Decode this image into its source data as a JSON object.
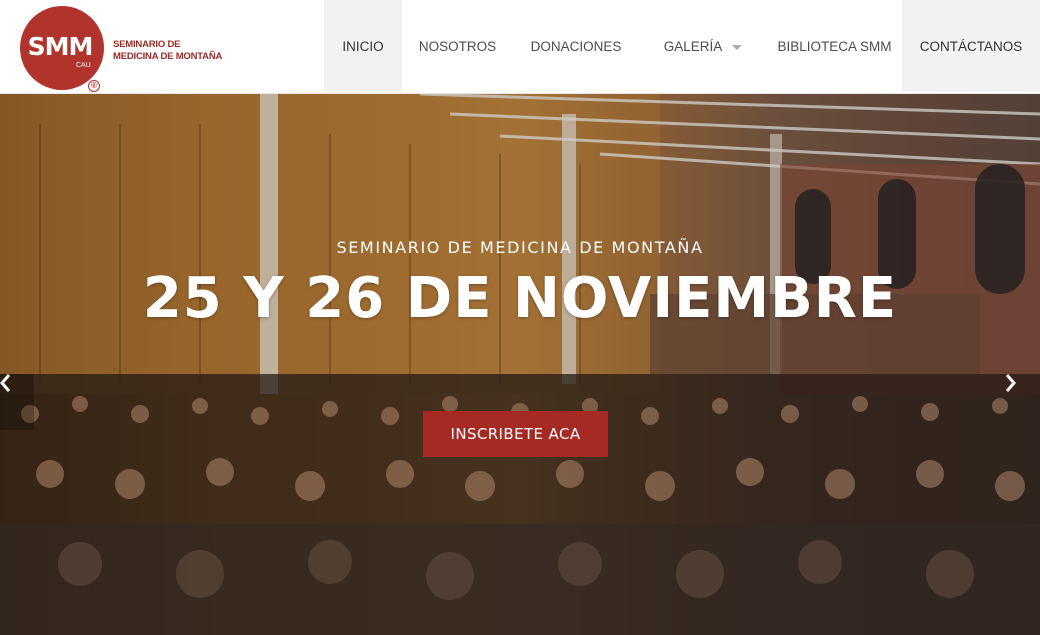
{
  "logo": {
    "mark": "SMM",
    "sub": "CAU",
    "registered": "®",
    "line1": "SEMINARIO DE",
    "line2": "MEDICINA DE MONTAÑA"
  },
  "nav": {
    "items": [
      {
        "label": "INICIO",
        "active": true
      },
      {
        "label": "NOSOTROS"
      },
      {
        "label": "DONACIONES"
      },
      {
        "label": "GALERÍA",
        "has_dropdown": true
      },
      {
        "label": "BIBLIOTECA SMM"
      },
      {
        "label": "CONTÁCTANOS"
      }
    ]
  },
  "hero": {
    "subtitle": "SEMINARIO DE MEDICINA DE MONTAÑA",
    "title": "25 Y 26 DE NOVIEMBRE",
    "cta_label": "INSCRIBETE ACA",
    "prev_icon": "chevron-left-icon",
    "next_icon": "chevron-right-icon"
  },
  "colors": {
    "brand": "#a52a24",
    "nav_active_bg": "#f2f2f2",
    "nav_text": "#4d4d4d"
  }
}
